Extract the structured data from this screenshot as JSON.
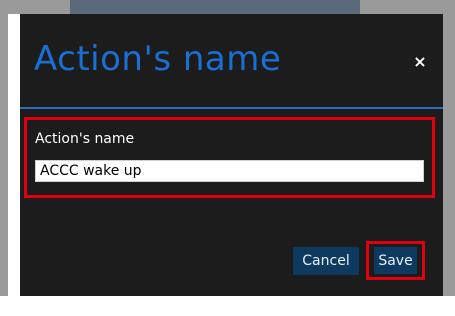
{
  "dialog": {
    "title": "Action's name",
    "close_icon": "close-icon",
    "close_glyph": "×"
  },
  "form": {
    "label": "Action's name",
    "value": "ACCC wake up"
  },
  "actions": {
    "cancel_label": "Cancel",
    "save_label": "Save"
  },
  "colors": {
    "title": "#1a6fd4",
    "dialog_background": "#1c1c1c",
    "divider": "#2a6cbf",
    "button_background": "#0d3a5e",
    "highlight_outline": "#e1000f"
  }
}
